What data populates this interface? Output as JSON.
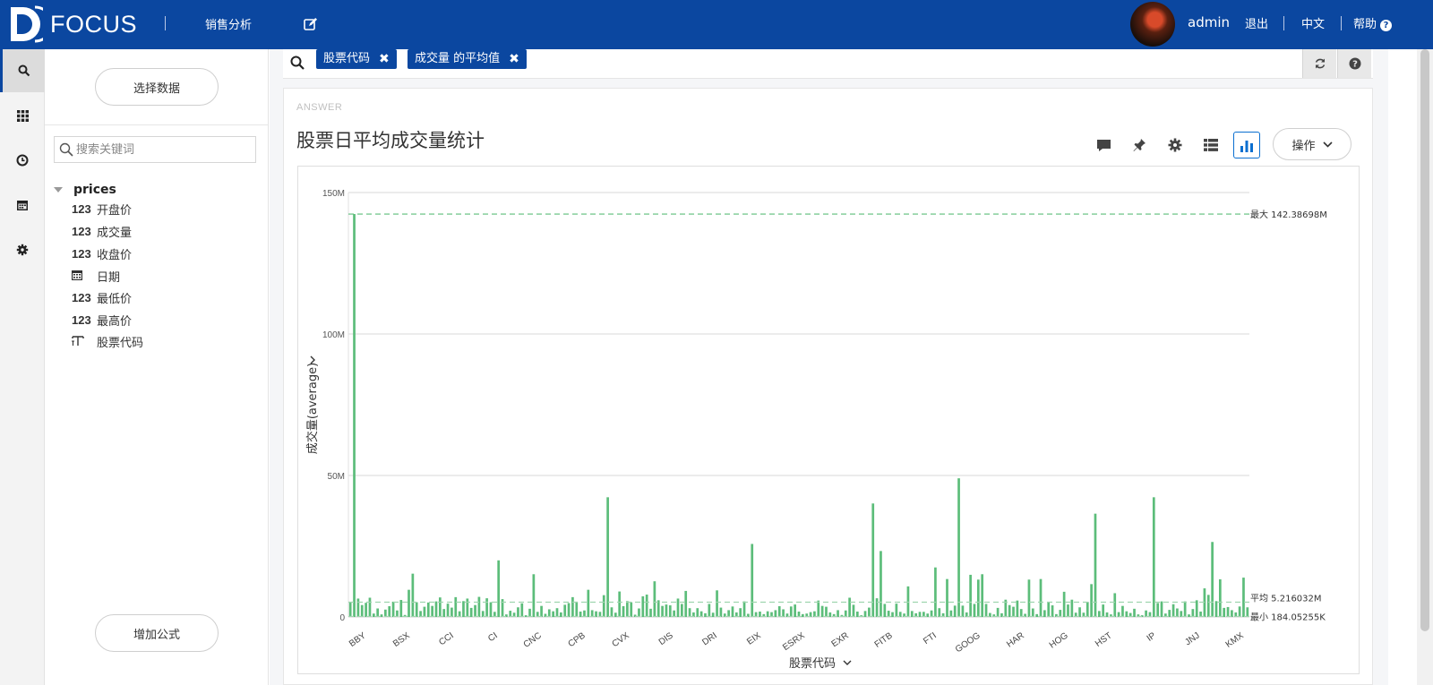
{
  "topbar": {
    "brand": "FOCUS",
    "nav_item": "销售分析",
    "user": "admin",
    "logout": "退出",
    "language": "中文",
    "help": "帮助",
    "bg_color": "#0b47a0"
  },
  "rail": {
    "items": [
      "search-icon",
      "grid-icon",
      "clock-icon",
      "calendar-icon",
      "gear-icon"
    ],
    "active": 0
  },
  "panel": {
    "select_data": "选择数据",
    "search_placeholder": "搜索关键词",
    "table_name": "prices",
    "fields": [
      {
        "type": "123",
        "name": "开盘价"
      },
      {
        "type": "123",
        "name": "成交量"
      },
      {
        "type": "123",
        "name": "收盘价"
      },
      {
        "type": "calendar-icon",
        "name": "日期"
      },
      {
        "type": "123",
        "name": "最低价"
      },
      {
        "type": "123",
        "name": "最高价"
      },
      {
        "type": "text-icon",
        "name": "股票代码"
      }
    ],
    "add_formula": "增加公式"
  },
  "query": {
    "chips": [
      "股票代码",
      "成交量 的平均值"
    ]
  },
  "answer": {
    "label": "ANSWER",
    "title": "股票日平均成交量统计",
    "ops": "操作"
  },
  "chart_data": {
    "type": "bar",
    "xlabel": "股票代码",
    "ylabel": "成交量(average)",
    "ylim": [
      0,
      150000000
    ],
    "y_ticks": [
      "0",
      "50M",
      "100M",
      "150M"
    ],
    "x_tick_labels": [
      "BBY",
      "BSX",
      "CCI",
      "CI",
      "CNC",
      "CPB",
      "CVX",
      "DIS",
      "DRI",
      "EIX",
      "ESRX",
      "EXR",
      "FITB",
      "FTI",
      "GOOG",
      "HAR",
      "HOG",
      "HST",
      "IP",
      "JNJ",
      "KMX"
    ],
    "reference_lines": [
      {
        "label": "最大",
        "value_text": "142.38698M",
        "value": 142386980,
        "color": "#5cbd7a"
      },
      {
        "label": "平均",
        "value_text": "5.216032M",
        "value": 5216032,
        "color": "#9fd5ae"
      },
      {
        "label": "最小",
        "value_text": "184.05255K",
        "value": 184053,
        "color": "#9fd5ae"
      }
    ],
    "bar_color": "#5cbd7a",
    "values": [
      5.1,
      142.4,
      6.5,
      4.2,
      5.0,
      6.8,
      1.2,
      3.0,
      0.9,
      2.6,
      3.8,
      5.4,
      2.3,
      6.0,
      0.7,
      9.6,
      15.3,
      5.2,
      2.1,
      3.6,
      5.1,
      3.9,
      5.5,
      6.9,
      2.8,
      4.7,
      3.3,
      7.0,
      2.0,
      5.6,
      6.5,
      3.2,
      4.2,
      7.1,
      2.1,
      6.6,
      5.2,
      1.8,
      20.0,
      6.3,
      0.9,
      2.2,
      1.5,
      3.4,
      4.8,
      0.6,
      2.9,
      15.1,
      1.8,
      3.9,
      1.1,
      2.7,
      2.0,
      3.1,
      1.6,
      4.3,
      4.9,
      7.0,
      5.4,
      1.9,
      2.3,
      9.6,
      2.4,
      2.0,
      1.8,
      7.7,
      42.3,
      3.4,
      1.5,
      9.0,
      3.8,
      5.6,
      5.2,
      0.8,
      3.0,
      7.3,
      7.9,
      2.9,
      12.6,
      5.9,
      3.9,
      4.4,
      4.1,
      2.3,
      6.5,
      4.6,
      9.2,
      3.1,
      1.6,
      3.1,
      2.0,
      1.3,
      4.6,
      1.5,
      9.4,
      3.3,
      1.2,
      2.4,
      3.7,
      1.6,
      3.1,
      5.5,
      1.1,
      25.8,
      1.7,
      1.9,
      1.0,
      2.0,
      1.7,
      2.4,
      3.8,
      2.7,
      1.2,
      3.7,
      4.4,
      1.9,
      1.0,
      1.2,
      1.7,
      2.0,
      5.8,
      3.9,
      3.6,
      1.6,
      1.0,
      2.4,
      0.7,
      2.3,
      6.8,
      4.3,
      1.9,
      0.6,
      2.1,
      3.3,
      40.1,
      6.6,
      23.3,
      4.6,
      2.2,
      1.7,
      4.7,
      1.8,
      1.2,
      10.8,
      2.1,
      1.3,
      1.8,
      1.8,
      1.2,
      2.3,
      17.5,
      3.1,
      1.3,
      13.4,
      2.3,
      4.0,
      49.0,
      4.0,
      1.6,
      14.9,
      4.6,
      13.2,
      15.1,
      4.6,
      1.4,
      0.9,
      3.2,
      1.3,
      6.1,
      4.2,
      3.6,
      5.8,
      2.8,
      1.1,
      13.2,
      3.0,
      1.0,
      13.4,
      2.4,
      5.3,
      4.1,
      1.0,
      2.5,
      8.9,
      4.4,
      6.1,
      1.5,
      3.4,
      1.5,
      5.3,
      11.6,
      36.5,
      2.1,
      4.4,
      1.6,
      0.9,
      8.4,
      1.7,
      3.9,
      2.0,
      1.4,
      2.9,
      0.9,
      0.6,
      2.3,
      1.7,
      42.3,
      4.9,
      5.5,
      1.2,
      2.5,
      4.5,
      3.0,
      2.1,
      5.5,
      0.9,
      2.8,
      5.9,
      1.9,
      10.1,
      7.8,
      26.5,
      5.6,
      13.3,
      3.2,
      3.5,
      2.4,
      1.6,
      3.7,
      13.9,
      3.4
    ]
  }
}
